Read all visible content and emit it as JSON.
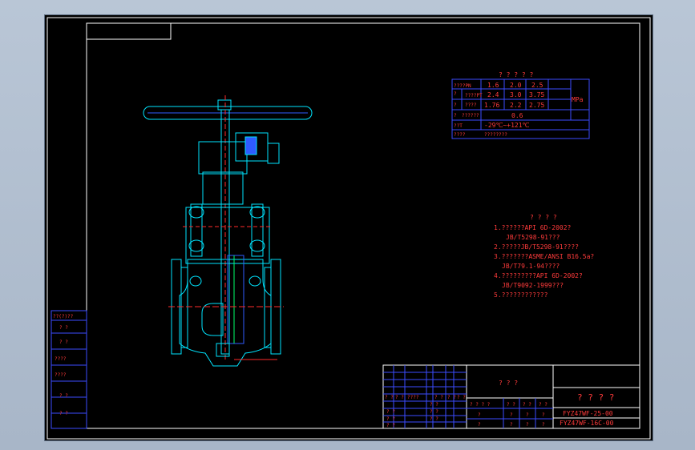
{
  "spec_table": {
    "title": "? ? ? ? ?",
    "rows": [
      {
        "label": "????PN",
        "v1": "1.6",
        "v2": "2.0",
        "v3": "2.5"
      },
      {
        "label": "????PT",
        "v1": "2.4",
        "v2": "3.0",
        "v3": "3.75"
      },
      {
        "label": "????",
        "v1": "1.76",
        "v2": "2.2",
        "v3": "2.75"
      },
      {
        "label": "??????",
        "v1": "",
        "v2": "0.6",
        "v3": ""
      }
    ],
    "side_marks": [
      "?",
      "?",
      "?",
      "?"
    ],
    "unit": "MPa",
    "temp_label": "??T",
    "temp_value": "-29℃~+121℃",
    "medium_label": "????",
    "medium_value": "????????"
  },
  "notes": {
    "title": "? ? ? ?",
    "lines": [
      "1.??????API 6D-2002?",
      "JB/T5298-91???",
      "2.?????JB/T5298-91????",
      "3.???????ASME/ANSI B16.5a?",
      "JB/T79.1-94????",
      "4.?????????API 6D-2002?",
      "JB/T9092-1999???",
      "5.????????????"
    ]
  },
  "side_block": {
    "cells": [
      "??(?)??",
      "?  ?",
      "?  ?",
      "????",
      "????",
      "?  ?",
      "?  ?"
    ]
  },
  "title_block": {
    "center_title": "? ? ?",
    "right_title": "? ? ? ?",
    "code1": "FYZ47WF-25-00",
    "code2": "FYZ47WF-16C-00",
    "left_header": [
      "? ?",
      "? ?",
      "????",
      "? ?",
      "? ?",
      "? ?"
    ],
    "left_rows": [
      "? ?",
      "? ?",
      "? ?"
    ],
    "mid_row1": [
      "? ? ? ?",
      "? ?",
      "? ?",
      "? ?"
    ],
    "mid_row2": [
      "?",
      "?",
      "?",
      "?"
    ],
    "sign_row": [
      "?",
      "?",
      "?",
      "?"
    ]
  },
  "colors": {
    "frame_white": "#ffffff",
    "valve_cyan": "#00e5ff",
    "valve_blue": "#2f5bff",
    "table_blue": "#3b4cff",
    "text_red": "#ff3b3b"
  }
}
